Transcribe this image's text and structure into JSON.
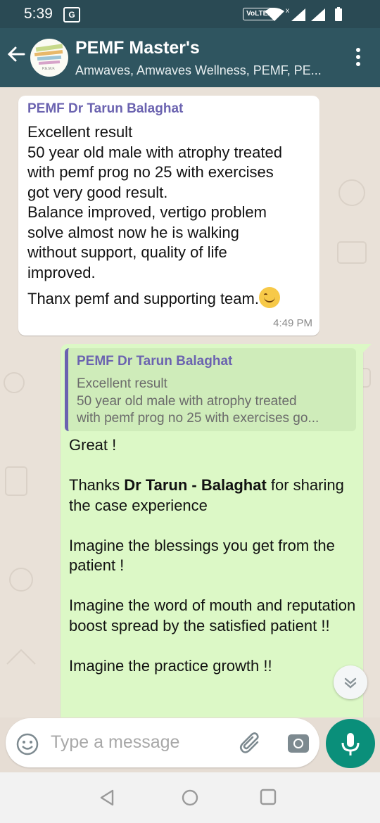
{
  "status_bar": {
    "time": "5:39",
    "translate_badge": "G",
    "network_label": "VoLTE2"
  },
  "header": {
    "title": "PEMF Master's",
    "subtitle": "Amwaves, Amwaves Wellness, PEMF, PE...",
    "avatar_caption": "P.E.M.F."
  },
  "messages": {
    "incoming": {
      "sender": "PEMF Dr Tarun Balaghat",
      "lines": [
        "Excellent result",
        "50 year old male with atrophy treated",
        "with pemf prog no 25 with exercises",
        "got very good result.",
        "Balance improved, vertigo problem",
        "solve almost now he is walking",
        "without support, quality of life",
        "improved."
      ],
      "last_line": "Thanx pemf and supporting team.",
      "emoji": "smiling-face",
      "time": "4:49 PM"
    },
    "outgoing": {
      "quote": {
        "sender": "PEMF Dr Tarun Balaghat",
        "line1": "Excellent result",
        "line2": "50 year old male with atrophy treated",
        "line3": "with pemf prog no 25 with exercises go..."
      },
      "p1": "Great !",
      "p2_pre": "Thanks ",
      "p2_bold": "Dr Tarun - Balaghat",
      "p2_post": " for sharing the case experience",
      "p3": "Imagine the blessings you get from the patient !",
      "p4": "Imagine the word of mouth and reputation boost spread by the satisfied patient !!",
      "p5": "Imagine the practice growth !!"
    }
  },
  "composer": {
    "placeholder": "Type a message"
  },
  "colors": {
    "app_bar": "#2f5560",
    "status_bar": "#2a4a54",
    "outgoing_bubble": "#dcf8c6",
    "incoming_bubble": "#ffffff",
    "sender_name": "#6b63b0",
    "mic_button": "#0a8f7a",
    "chat_background": "#e9e1d8"
  }
}
